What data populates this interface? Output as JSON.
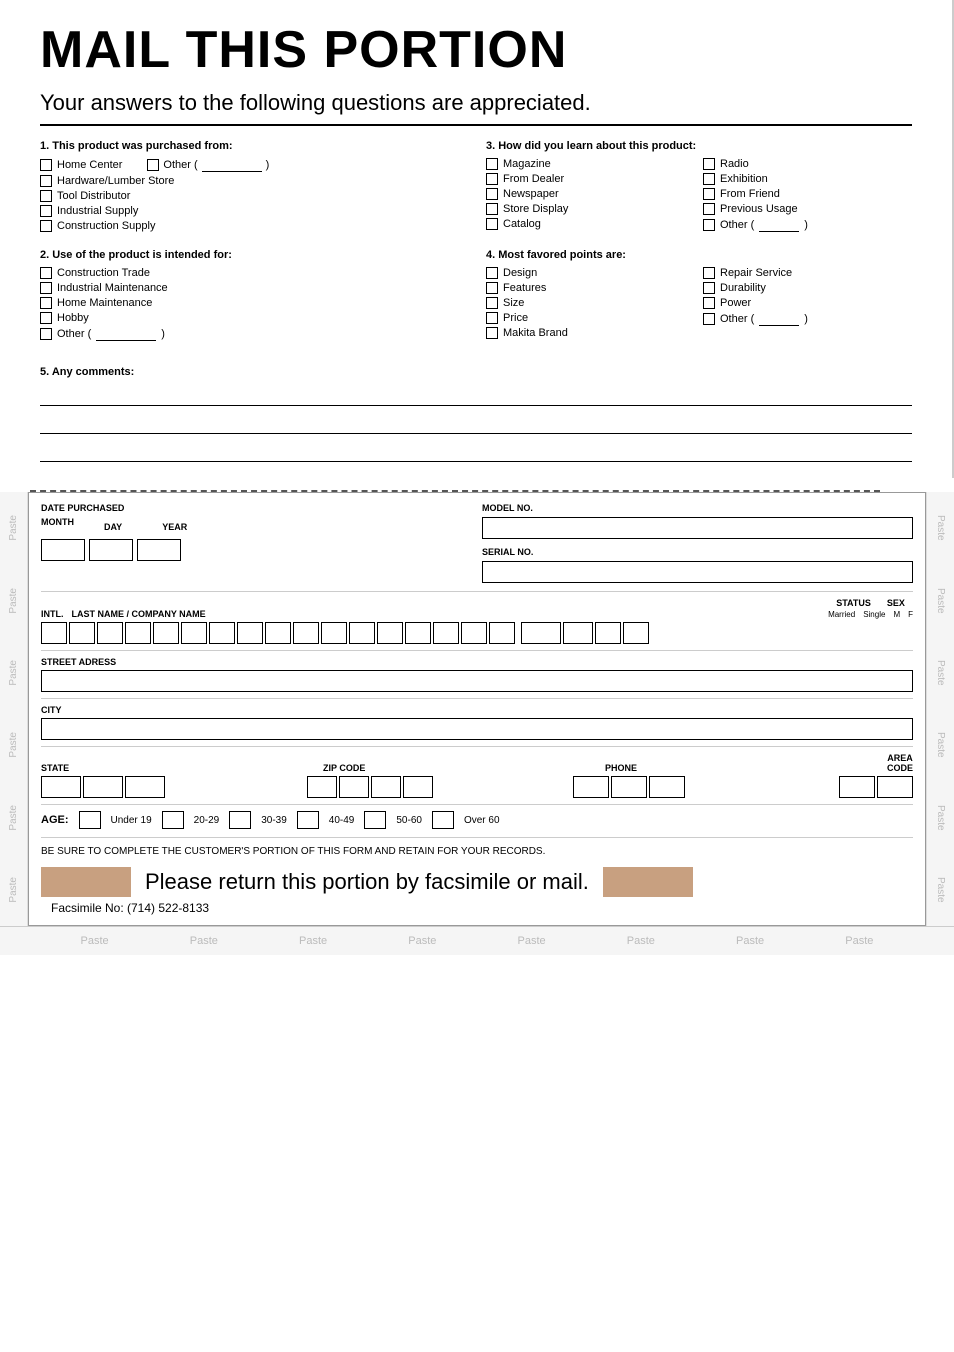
{
  "header": {
    "title": "MAIL THIS PORTION",
    "subtitle": "Your answers to the following questions are appreciated."
  },
  "q1": {
    "title": "1. This product was purchased from:",
    "options": [
      "Home Center",
      "Hardware/Lumber Store",
      "Tool Distributor",
      "Industrial Supply",
      "Construction Supply"
    ],
    "other_label": "Other ("
  },
  "q2": {
    "title": "2. Use of the product is intended for:",
    "options": [
      "Construction Trade",
      "Industrial Maintenance",
      "Home Maintenance",
      "Hobby",
      "Other ("
    ]
  },
  "q3": {
    "title": "3. How did you learn about this product:",
    "col1": [
      "Magazine",
      "From Dealer",
      "Newspaper",
      "Store Display",
      "Catalog"
    ],
    "col2": [
      "Radio",
      "Exhibition",
      "From Friend",
      "Previous Usage",
      "Other ("
    ]
  },
  "q4": {
    "title": "4. Most favored points are:",
    "col1": [
      "Design",
      "Features",
      "Size",
      "Price",
      "Makita Brand"
    ],
    "col2": [
      "Repair Service",
      "Durability",
      "Power",
      "Other ("
    ]
  },
  "q5": {
    "title": "5. Any comments:"
  },
  "form": {
    "date_purchased": "DATE PURCHASED",
    "month_label": "MONTH",
    "day_label": "DAY",
    "year_label": "YEAR",
    "model_no": "MODEL NO.",
    "serial_no": "SERIAL NO.",
    "intl_label": "INTL.",
    "name_label": "LAST NAME / COMPANY NAME",
    "status_label": "STATUS",
    "married_label": "Married",
    "single_label": "Single",
    "sex_label": "SEX",
    "m_label": "M",
    "f_label": "F",
    "street_label": "STREET ADRESS",
    "city_label": "CITY",
    "state_label": "STATE",
    "zip_label": "ZIP CODE",
    "phone_label": "PHONE",
    "area_code_label": "AREA\nCODE",
    "age_label": "AGE:",
    "age_options": [
      "Under 19",
      "20-29",
      "30-39",
      "40-49",
      "50-60",
      "Over 60"
    ],
    "retain_text": "BE SURE TO COMPLETE THE CUSTOMER'S PORTION OF THIS FORM AND RETAIN FOR YOUR RECORDS.",
    "return_text": "Please return this portion by facsimile or mail.",
    "fax_text": "Facsimile No: (714) 522-8133"
  },
  "paste_labels": {
    "left": [
      "Paste",
      "Paste",
      "Paste",
      "Paste",
      "Paste",
      "Paste"
    ],
    "right": [
      "Paste",
      "Paste",
      "Paste",
      "Paste",
      "Paste",
      "Paste"
    ],
    "bottom": [
      "Paste",
      "Paste",
      "Paste",
      "Paste",
      "Paste",
      "Paste",
      "Paste",
      "Paste"
    ]
  }
}
